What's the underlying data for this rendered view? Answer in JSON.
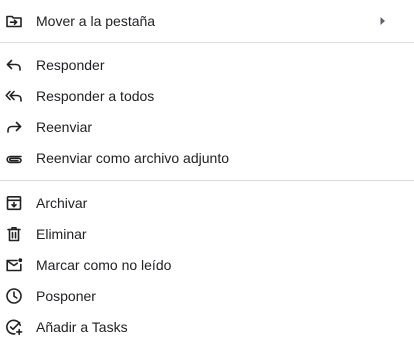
{
  "menu": {
    "items": [
      {
        "label": "Mover a la pestaña",
        "icon": "move-to-tab-icon",
        "has_submenu": true
      },
      {
        "label": "Responder",
        "icon": "reply-icon"
      },
      {
        "label": "Responder a todos",
        "icon": "reply-all-icon"
      },
      {
        "label": "Reenviar",
        "icon": "forward-icon"
      },
      {
        "label": "Reenviar como archivo adjunto",
        "icon": "attachment-icon"
      },
      {
        "label": "Archivar",
        "icon": "archive-icon"
      },
      {
        "label": "Eliminar",
        "icon": "trash-icon"
      },
      {
        "label": "Marcar como no leído",
        "icon": "mark-unread-icon"
      },
      {
        "label": "Posponer",
        "icon": "clock-icon"
      },
      {
        "label": "Añadir a Tasks",
        "icon": "add-to-tasks-icon"
      }
    ]
  },
  "colors": {
    "text": "#202124",
    "icon": "#202124",
    "divider": "#dadce0",
    "submenu_arrow": "#5f6368"
  }
}
